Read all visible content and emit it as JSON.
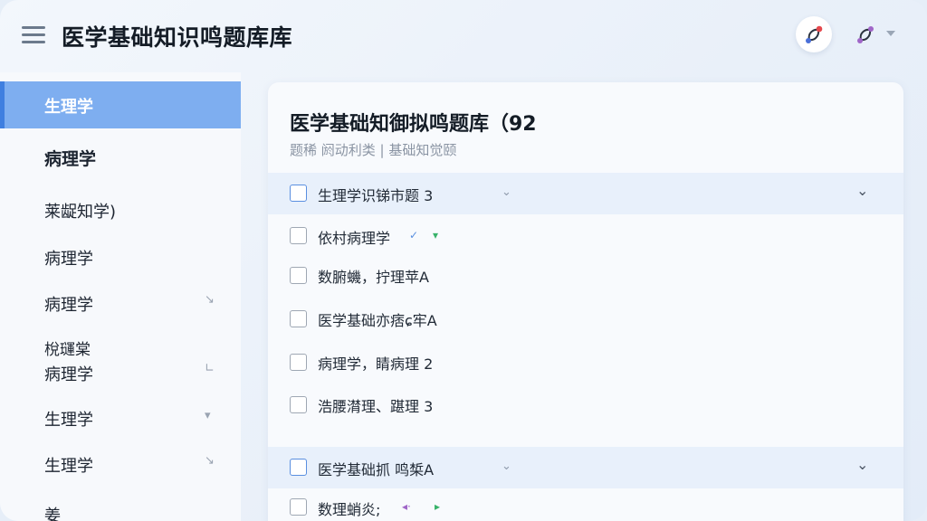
{
  "header": {
    "title": "医学基础知识鸣题库库",
    "icons": {
      "menu": "hamburger-menu-icon",
      "btn1": "share-node-icon",
      "btn2": "share-node-icon",
      "caret": "caret-down-icon"
    }
  },
  "colors": {
    "accent": "#7eaef0",
    "accent_dark": "#3f7fe0",
    "notify": "#e5484d",
    "node_purple": "#a066c8",
    "node_blue": "#4a6fd8",
    "check_blue": "#5a8fe0",
    "tri_green": "#38b26a"
  },
  "sidebar": {
    "items": [
      {
        "label": "生理学",
        "active": true
      },
      {
        "label": "病理学",
        "bold": true
      },
      {
        "label": "莱龊知学)"
      },
      {
        "label": "病理学"
      },
      {
        "label": "病理学",
        "chevron": "↘"
      },
      {
        "label_lines": [
          "梲璭棠",
          "病理学"
        ],
        "chevron": "∟"
      },
      {
        "label": "生理学",
        "chevron": "▾"
      },
      {
        "label": "生理学",
        "chevron": "↘"
      },
      {
        "label": "姜"
      }
    ]
  },
  "card": {
    "title": "医学基础知御拟鸣题库（92",
    "subtitle": "题稀 阏动利类 | 基础知觉颐",
    "group1": {
      "label": "生理学识锑市题 3"
    },
    "rows1": [
      {
        "label": "依村病理学",
        "tag1": "✓",
        "tag2": "▾"
      },
      {
        "label": "数腑蟣，拧理苹A"
      },
      {
        "label": "医学基础亦痞ɕ牢A"
      },
      {
        "label": "病理学，睛病理 2"
      },
      {
        "label": "浩腰潸理、踸理 3"
      }
    ],
    "group2": {
      "label": "医学基础抓 鸣椞A"
    },
    "rows2": [
      {
        "label": "数理蛸炎;",
        "tag1": "◂·",
        "tag2": "▸"
      }
    ]
  }
}
